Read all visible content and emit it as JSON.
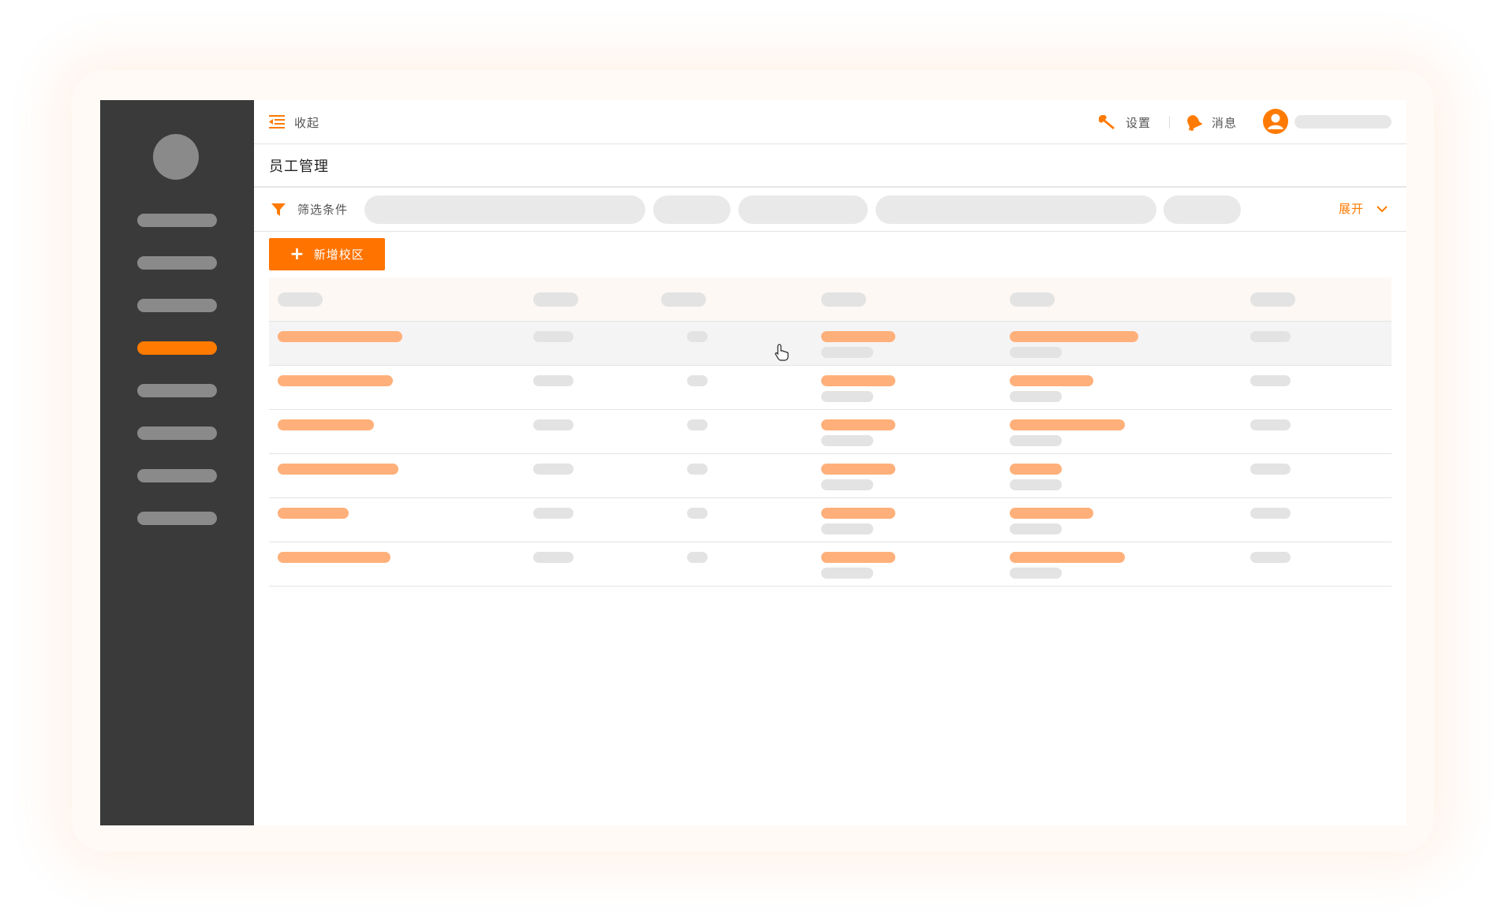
{
  "topbar": {
    "collapse_label": "收起",
    "settings_label": "设置",
    "messages_label": "消息"
  },
  "page": {
    "title": "员工管理"
  },
  "filter": {
    "label": "筛选条件",
    "expand_label": "展开"
  },
  "actions": {
    "add_button_label": "新增校区",
    "add_button_icon": "plus-icon"
  },
  "icons": {
    "collapse": "collapse-menu-icon",
    "settings": "wrench-icon",
    "messages": "bell-icon",
    "user": "user-avatar-icon",
    "filter": "funnel-icon",
    "expand": "chevron-down-icon",
    "cursor": "hand-pointer-icon"
  },
  "table": {
    "column_count": 6,
    "row_count": 6
  },
  "colors": {
    "accent": "#ff7a00",
    "sidebar_bg": "#3a3a3a",
    "placeholder_gray": "#e3e3e3",
    "placeholder_orange": "#ffb07a"
  }
}
